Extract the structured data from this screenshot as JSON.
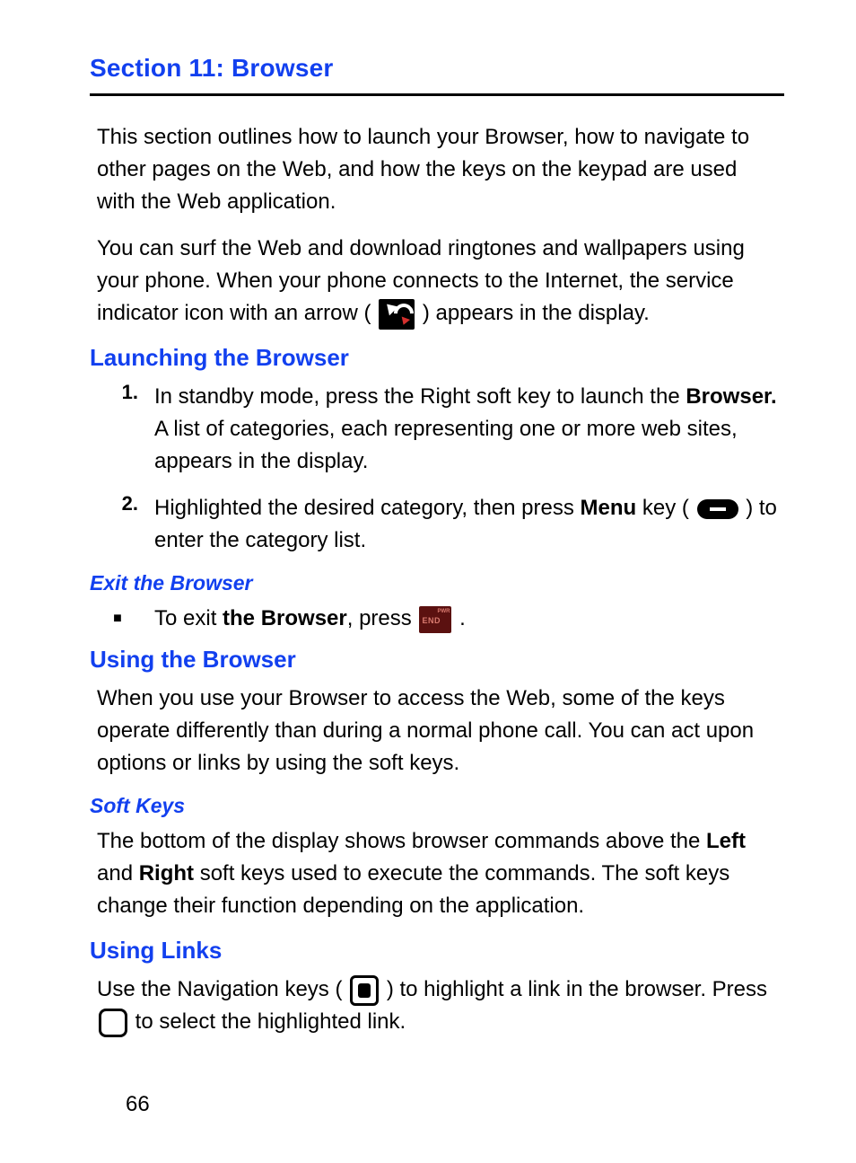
{
  "section": {
    "title": "Section 11: Browser",
    "intro1": "This section outlines how to launch your Browser, how to navigate to other pages on the Web, and how the keys on the keypad are used with the Web application.",
    "intro2_a": "You can surf the Web and download ringtones and wallpapers using your phone. When your phone connects to the Internet, the service indicator icon with an arrow (",
    "intro2_b": ") appears in the display."
  },
  "launch": {
    "heading": "Launching the Browser",
    "items": [
      {
        "num": "1.",
        "text_a": "In standby mode, press the Right soft key to launch the ",
        "bold_a": "Browser.",
        "text_b": " A list of categories, each representing one or more web sites, appears in the display."
      },
      {
        "num": "2.",
        "text_a": "Highlighted the desired category, then press ",
        "bold_a": "Menu",
        "text_b": " key (",
        "text_c": ") to enter the category list."
      }
    ],
    "exit": {
      "heading": "Exit the Browser",
      "text_a": "To exit ",
      "bold_a": "the Browser",
      "text_b": ", press ",
      "text_c": "."
    }
  },
  "using": {
    "heading": "Using the Browser",
    "body": "When you use your Browser to access the Web, some of the keys operate differently than during a normal phone call. You can act upon options or links by using the soft keys.",
    "softkeys": {
      "heading": "Soft Keys",
      "text_a": "The bottom of the display shows browser commands above the ",
      "bold_a": "Left",
      "text_b": " and ",
      "bold_b": "Right",
      "text_c": " soft keys used to execute the commands. The soft keys change their function depending on the application."
    }
  },
  "links": {
    "heading": "Using Links",
    "text_a": "Use the Navigation keys (",
    "text_b": ") to highlight a link in the browser. Press ",
    "text_c": " to select the highlighted link."
  },
  "page_number": "66"
}
